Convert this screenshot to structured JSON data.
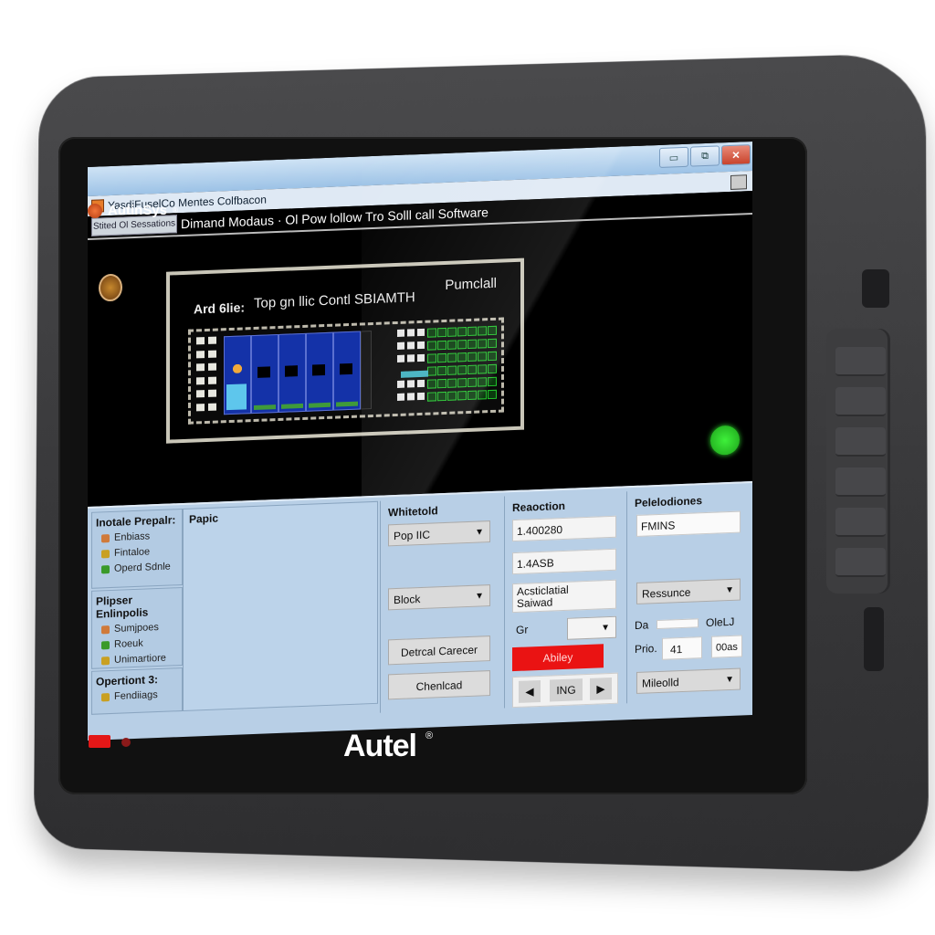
{
  "device": {
    "brand": "Autel",
    "brand_mark": "®",
    "power_led_color": "#e31717",
    "status_led_color": "#2bd02a"
  },
  "window": {
    "app_name": "AutinSys",
    "app_mark": "®",
    "subtitle": "YasdiFuselCo Mentes Colfbacon",
    "controls": {
      "minimize": "▭",
      "maximize": "⧉",
      "close": "✕"
    }
  },
  "toolbar": {
    "mode_button": "Stited Ol Sessations",
    "title": "Dimand Modaus · Ol Pow lollow Tro Solll call Software"
  },
  "schematic": {
    "left_label": "Ard 6lie:",
    "title": "Top gn llic Contl SBIAMTH",
    "right_label": "Pumclall",
    "bays": 5
  },
  "sidebar": {
    "sections": [
      {
        "title": "Inotale Prepalr:",
        "items": [
          {
            "label": "Enbiass",
            "icon": "gear-icon",
            "color": "#d07a3a"
          },
          {
            "label": "Fintaloe",
            "icon": "check-icon",
            "color": "#c9a022"
          },
          {
            "label": "Operd Sdnle",
            "icon": "check-icon",
            "color": "#3a9a2a"
          }
        ]
      },
      {
        "title": "Plipser Enlinpolis",
        "items": [
          {
            "label": "Sumjpoes",
            "icon": "tool-icon",
            "color": "#d07a3a"
          },
          {
            "label": "Roeuk",
            "icon": "refresh-icon",
            "color": "#3a9a2a"
          },
          {
            "label": "Unimartiore",
            "icon": "check-icon",
            "color": "#c9a022"
          }
        ]
      },
      {
        "title": "Opertiont 3:",
        "items": [
          {
            "label": "Fendiiags",
            "icon": "check-icon",
            "color": "#c9a022"
          }
        ]
      }
    ]
  },
  "content": {
    "title": "Papic"
  },
  "column_whitetold": {
    "title": "Whitetold",
    "dropdown1": "Pop IIC",
    "dropdown2": "Block",
    "button1": "Detrcal Carecer",
    "button2": "Chenlcad"
  },
  "column_reaction": {
    "title": "Reaoction",
    "field1": "1.400280",
    "field2": "1.4ASB",
    "field3_line1": "Acsticlatial",
    "field3_line2": "Saiwad",
    "gr_label": "Gr",
    "gr_value": "",
    "apply_button": "Abiley",
    "nav_prev": "◀",
    "nav_center": "ING",
    "nav_next": "▶"
  },
  "column_pelelodiones": {
    "title": "Pelelodiones",
    "field1": "FMINS",
    "dropdown1": "Ressunce",
    "da_label": "Da",
    "da_value": "",
    "olel_label": "OleLJ",
    "prio_label": "Prio.",
    "prio_value": "41",
    "code_value": "00as",
    "dropdown2": "Mileolld"
  }
}
